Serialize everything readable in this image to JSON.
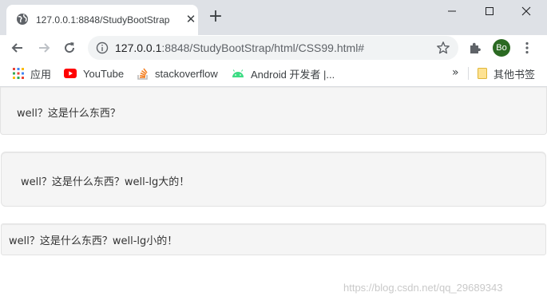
{
  "browser": {
    "tab": {
      "title": "127.0.0.1:8848/StudyBootStrap",
      "close_glyph": "✕"
    },
    "new_tab_glyph": "+",
    "omnibox": {
      "url_host": "127.0.0.1",
      "url_rest": ":8848/StudyBootStrap/html/CSS99.html#"
    },
    "profile_initials": "Bo",
    "bookmarks": [
      {
        "label": "应用",
        "icon": "apps-grid-icon"
      },
      {
        "label": "YouTube",
        "icon": "youtube-icon"
      },
      {
        "label": "stackoverflow",
        "icon": "stackoverflow-icon"
      },
      {
        "label": "Android 开发者  |...",
        "icon": "android-icon"
      }
    ],
    "bookmarks_more": "»",
    "other_bookmarks": {
      "label": "其他书签",
      "icon": "folder-icon"
    }
  },
  "page": {
    "well_default": "well？这是什么东西？",
    "well_lg": "well？这是什么东西？well-lg大的！",
    "well_sm": "well？这是什么东西？well-lg小的！"
  },
  "watermark": "https://blog.csdn.net/qq_29689343"
}
